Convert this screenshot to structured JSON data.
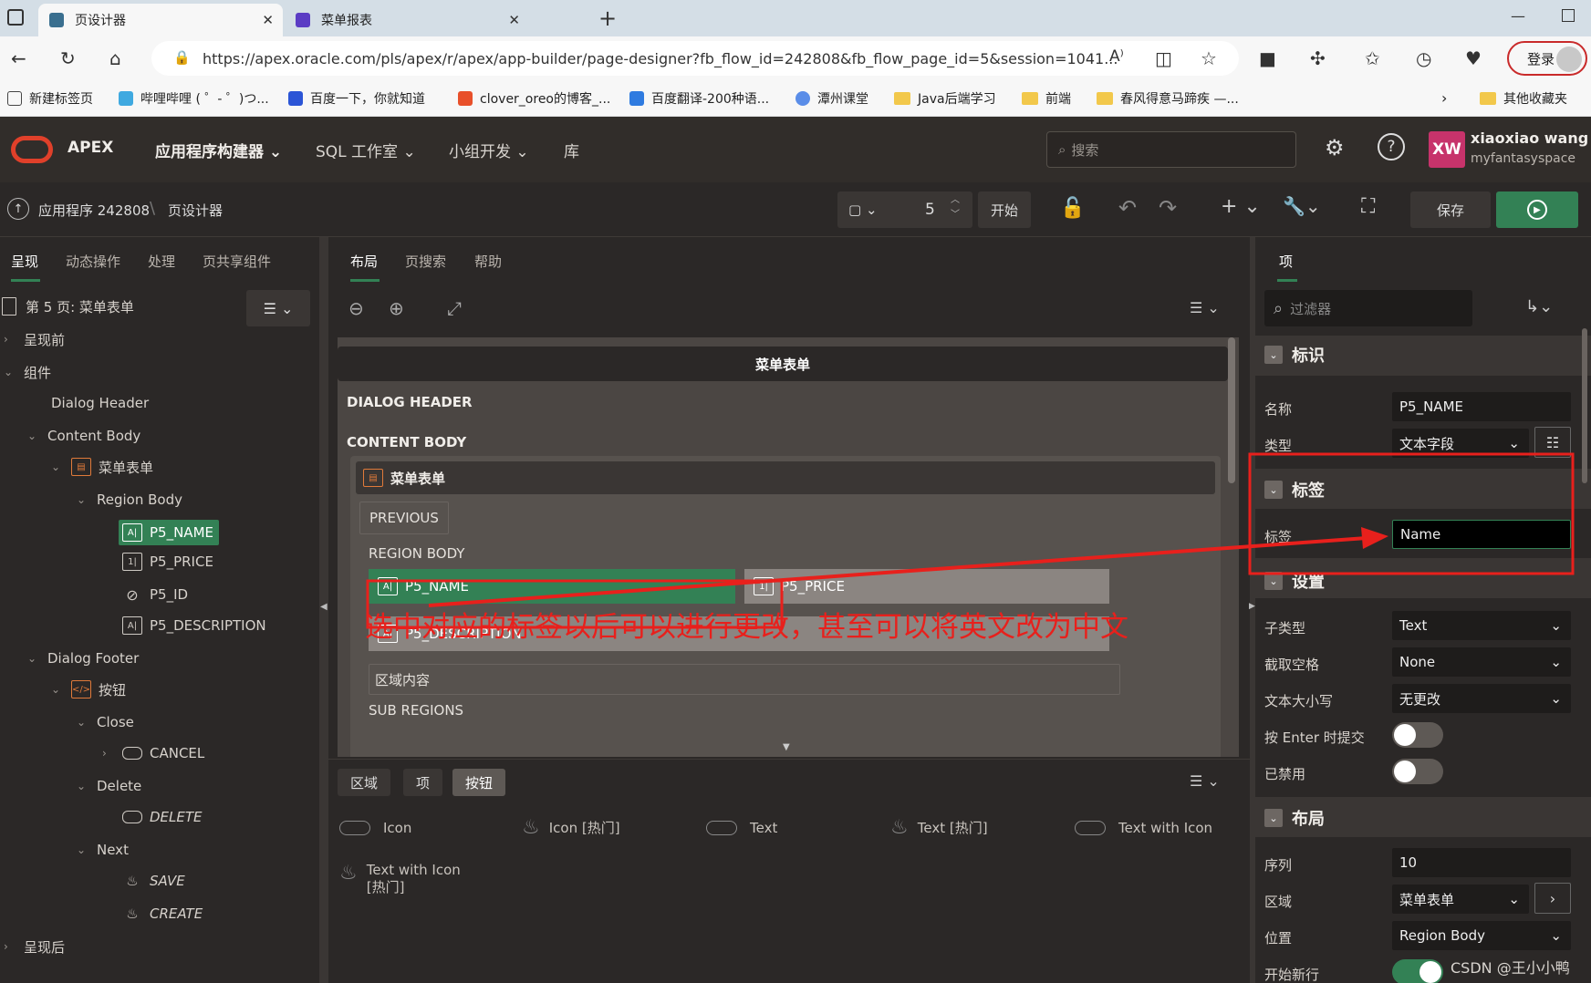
{
  "browser": {
    "tabs": [
      {
        "title": "页设计器",
        "active": true
      },
      {
        "title": "菜单报表",
        "active": false
      }
    ],
    "url": "https://apex.oracle.com/pls/apex/r/apex/app-builder/page-designer?fb_flow_id=242808&fb_flow_page_id=5&session=1041...",
    "login_label": "登录",
    "bookmarks": [
      "新建标签页",
      "哔哩哔哩 ( ゜- ゜)つ...",
      "百度一下，你就知道",
      "clover_oreo的博客_...",
      "百度翻译-200种语...",
      "潭州课堂",
      "Java后端学习",
      "前端",
      "春风得意马蹄疾 —..."
    ],
    "other_bookmarks": "其他收藏夹"
  },
  "apex": {
    "brand": "APEX",
    "nav": [
      "应用程序构建器",
      "SQL 工作室",
      "小组开发",
      "库"
    ],
    "search_placeholder": "搜索",
    "user_initials": "XW",
    "user_name": "xiaoxiao wang",
    "workspace": "myfantasyspace"
  },
  "toolbar": {
    "app_breadcrumb": "应用程序 242808",
    "page_breadcrumb": "页设计器",
    "page_number": "5",
    "start_label": "开始",
    "save_label": "保存"
  },
  "left": {
    "tabs": [
      "呈现",
      "动态操作",
      "处理",
      "页共享组件"
    ],
    "page_title": "第 5 页: 菜单表单",
    "tree": {
      "before": "呈现前",
      "components": "组件",
      "dialog_header": "Dialog Header",
      "content_body": "Content Body",
      "region": "菜单表单",
      "region_body": "Region Body",
      "items": [
        "P5_NAME",
        "P5_PRICE",
        "P5_ID",
        "P5_DESCRIPTION"
      ],
      "dialog_footer": "Dialog Footer",
      "buttons": "按钮",
      "close": "Close",
      "cancel": "CANCEL",
      "delete_group": "Delete",
      "delete": "DELETE",
      "next": "Next",
      "save": "SAVE",
      "create": "CREATE",
      "after": "呈现后"
    }
  },
  "center": {
    "tabs": [
      "布局",
      "页搜索",
      "帮助"
    ],
    "page_header": "菜单表单",
    "dialog_header": "DIALOG HEADER",
    "content_body": "CONTENT BODY",
    "region_title": "菜单表单",
    "previous": "PREVIOUS",
    "region_body": "REGION BODY",
    "item_name": "P5_NAME",
    "item_price": "P5_PRICE",
    "item_description": "P5_DESCRIPTION",
    "region_content": "区域内容",
    "sub_regions": "SUB REGIONS",
    "annotation": "选中对应的标签以后可以进行更改，甚至可以将英文改为中文",
    "gallery_tabs": [
      "区域",
      "项",
      "按钮"
    ],
    "gallery_items": [
      "Icon",
      "Icon [热门]",
      "Text",
      "Text [热门]",
      "Text with Icon",
      "Text with Icon [热门]"
    ]
  },
  "right": {
    "tab": "项",
    "filter_placeholder": "过滤器",
    "sec_identity": "标识",
    "name_label": "名称",
    "name_value": "P5_NAME",
    "type_label": "类型",
    "type_value": "文本字段",
    "sec_label": "标签",
    "label_label": "标签",
    "label_value": "Name",
    "sec_settings": "设置",
    "subtype_label": "子类型",
    "subtype_value": "Text",
    "trim_label": "截取空格",
    "trim_value": "None",
    "case_label": "文本大小写",
    "case_value": "无更改",
    "enter_submit_label": "按 Enter 时提交",
    "disabled_label": "已禁用",
    "sec_layout": "布局",
    "seq_label": "序列",
    "seq_value": "10",
    "region_label": "区域",
    "region_value": "菜单表单",
    "position_label": "位置",
    "position_value": "Region Body",
    "new_row_label": "开始新行"
  },
  "watermark": "CSDN @王小小鸭",
  "colors": {
    "accent_green": "#338155",
    "annotation_red": "#e8201c",
    "apex_red": "#e0402a"
  }
}
